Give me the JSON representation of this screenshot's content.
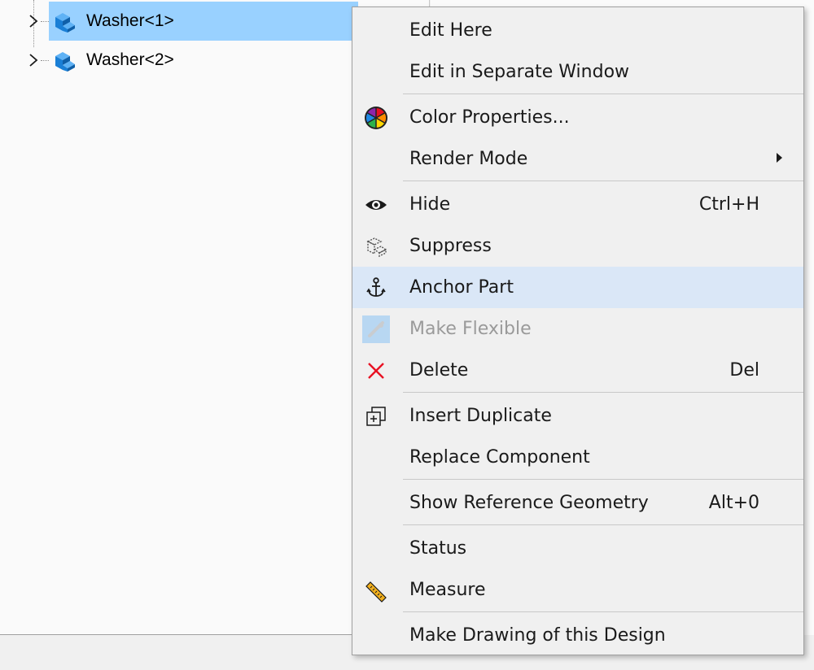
{
  "tree": {
    "items": [
      {
        "label": "Washer<1>",
        "selected": true,
        "icon": "part-icon"
      },
      {
        "label": "Washer<2>",
        "selected": false,
        "icon": "part-icon"
      }
    ]
  },
  "context_menu": {
    "items": [
      {
        "label": "Edit Here",
        "icon": "",
        "shortcut": "",
        "disabled": false
      },
      {
        "label": "Edit in Separate Window",
        "icon": "",
        "shortcut": "",
        "disabled": false
      },
      {
        "label": "Color Properties...",
        "icon": "color-wheel-icon",
        "shortcut": "",
        "disabled": false
      },
      {
        "label": "Render Mode",
        "icon": "",
        "shortcut": "",
        "disabled": false,
        "submenu": true
      },
      {
        "label": "Hide",
        "icon": "eye-icon",
        "shortcut": "Ctrl+H",
        "disabled": false
      },
      {
        "label": "Suppress",
        "icon": "suppress-part-icon",
        "shortcut": "",
        "disabled": false
      },
      {
        "label": "Anchor Part",
        "icon": "anchor-icon",
        "shortcut": "",
        "disabled": false,
        "hovered": true
      },
      {
        "label": "Make Flexible",
        "icon": "flexible-icon",
        "shortcut": "",
        "disabled": true
      },
      {
        "label": "Delete",
        "icon": "delete-x-icon",
        "shortcut": "Del",
        "disabled": false
      },
      {
        "label": "Insert Duplicate",
        "icon": "insert-duplicate-icon",
        "shortcut": "",
        "disabled": false
      },
      {
        "label": "Replace Component",
        "icon": "",
        "shortcut": "",
        "disabled": false
      },
      {
        "label": "Show Reference Geometry",
        "icon": "",
        "shortcut": "Alt+0",
        "disabled": false
      },
      {
        "label": "Status",
        "icon": "",
        "shortcut": "",
        "disabled": false
      },
      {
        "label": "Measure",
        "icon": "ruler-icon",
        "shortcut": "",
        "disabled": false
      },
      {
        "label": "Make Drawing of this Design",
        "icon": "",
        "shortcut": "",
        "disabled": false
      }
    ]
  },
  "colors": {
    "selection": "#99d1ff",
    "menu_hover": "#dae7f7",
    "delete_red": "#e81123",
    "part_blue": "#1a7fd6"
  }
}
